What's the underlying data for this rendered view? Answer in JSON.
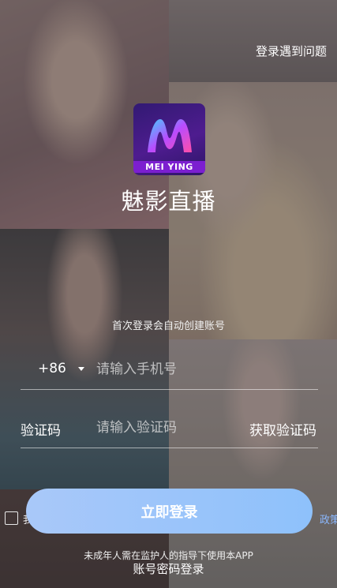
{
  "header": {
    "help_link": "登录遇到问题"
  },
  "brand": {
    "logo_text": "MEI YING",
    "app_name": "魅影直播"
  },
  "hint": "首次登录会自动创建账号",
  "phone": {
    "country_code": "+86",
    "placeholder": "请输入手机号",
    "value": ""
  },
  "code": {
    "label": "验证码",
    "placeholder": "请输入验证码",
    "value": "",
    "get_code": "获取验证码"
  },
  "agreement": {
    "prefix": "我",
    "policy_link": "政策"
  },
  "login_button": "立即登录",
  "minor_notice": "未成年人需在监护人的指导下使用本APP",
  "password_login": "账号密码登录",
  "colors": {
    "button": "#8ec1fb",
    "policy_link": "#8bb8ff",
    "logo_bg": "#4e1c8f"
  }
}
